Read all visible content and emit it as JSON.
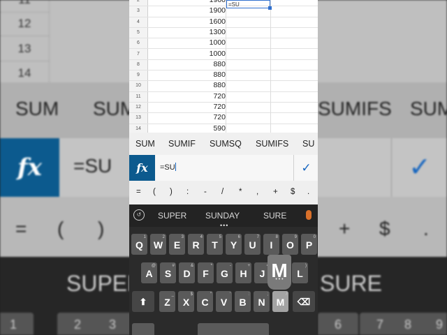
{
  "background": {
    "row_numbers": [
      "11",
      "12",
      "13",
      "14"
    ],
    "suggestions": [
      "SUM",
      "SUMIF",
      "SUMIFS",
      "SUMI"
    ],
    "formula_input": "=SU",
    "symbols": [
      "=",
      "(",
      ")",
      "+",
      "$",
      "."
    ],
    "keyboard_words": [
      "SUPER",
      "SURE"
    ],
    "number_keys": [
      "1",
      "2",
      "3",
      "6",
      "7",
      "8",
      "9"
    ]
  },
  "sheet": {
    "rows": [
      {
        "num": "2",
        "value": "1900"
      },
      {
        "num": "3",
        "value": "1900"
      },
      {
        "num": "4",
        "value": "1600"
      },
      {
        "num": "5",
        "value": "1300"
      },
      {
        "num": "6",
        "value": "1000"
      },
      {
        "num": "7",
        "value": "1000"
      },
      {
        "num": "8",
        "value": "880"
      },
      {
        "num": "9",
        "value": "880"
      },
      {
        "num": "10",
        "value": "880"
      },
      {
        "num": "11",
        "value": "720"
      },
      {
        "num": "12",
        "value": "720"
      },
      {
        "num": "13",
        "value": "720"
      },
      {
        "num": "14",
        "value": "590"
      }
    ],
    "selected_cell_text": "=SU"
  },
  "function_suggestions": [
    "SUM",
    "SUMIF",
    "SUMSQ",
    "SUMIFS",
    "SU"
  ],
  "formula_bar": {
    "fx_label": "fx",
    "input_value": "=SU",
    "confirm_icon": "check-icon"
  },
  "symbol_row": [
    "=",
    "(",
    ")",
    ":",
    "-",
    "/",
    "*",
    ",",
    "+",
    "$",
    "."
  ],
  "keyboard": {
    "suggestions": [
      "SUPER",
      "SUNDAY",
      "SURE"
    ],
    "row1": [
      {
        "k": "Q",
        "s": "1"
      },
      {
        "k": "W",
        "s": "2"
      },
      {
        "k": "E",
        "s": "3"
      },
      {
        "k": "R",
        "s": "4"
      },
      {
        "k": "T",
        "s": "5"
      },
      {
        "k": "Y",
        "s": "6"
      },
      {
        "k": "U",
        "s": "7"
      },
      {
        "k": "I",
        "s": "8"
      },
      {
        "k": "O",
        "s": "9"
      },
      {
        "k": "P",
        "s": "0"
      }
    ],
    "row2": [
      {
        "k": "A",
        "s": "@"
      },
      {
        "k": "S",
        "s": "#"
      },
      {
        "k": "D",
        "s": "&"
      },
      {
        "k": "F",
        "s": "*"
      },
      {
        "k": "G",
        "s": "-"
      },
      {
        "k": "H",
        "s": "+"
      },
      {
        "k": "J",
        "s": "="
      },
      {
        "k": "K",
        "s": "("
      },
      {
        "k": "L",
        "s": ")"
      }
    ],
    "row3": [
      {
        "k": "Z",
        "s": "_"
      },
      {
        "k": "X",
        "s": "$"
      },
      {
        "k": "C",
        "s": "\""
      },
      {
        "k": "V",
        "s": "'"
      },
      {
        "k": "B",
        "s": ":"
      },
      {
        "k": "N",
        "s": ";"
      },
      {
        "k": "M",
        "s": "/"
      }
    ],
    "pressed_key": "M",
    "popup_letter": "M",
    "shift_icon": "shift-up-arrow-icon",
    "backspace_icon": "backspace-icon"
  }
}
